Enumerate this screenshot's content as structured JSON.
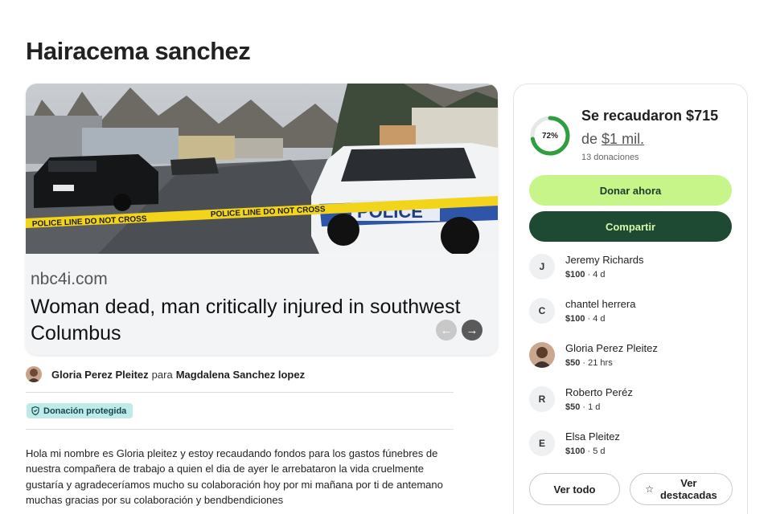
{
  "page": {
    "title": "Hairacema sanchez"
  },
  "media": {
    "image_alt": "Police car behind police line tape at a mobile home park",
    "tape_text": "POLICE LINE  DO NOT CROSS",
    "car_text": "POLICE",
    "caption_source": "nbc4i.com",
    "caption_headline": "Woman dead, man critically injured in southwest Columbus",
    "prev_icon": "arrow-left-icon",
    "next_icon": "arrow-right-icon"
  },
  "organizer": {
    "name": "Gloria Perez Pleitez",
    "connector": "para",
    "beneficiary": "Magdalena Sanchez lopez"
  },
  "badge": {
    "label": "Donación protegida",
    "icon": "shield-icon"
  },
  "description": "Hola mi nombre es Gloria pleitez y estoy recaudando fondos para los gastos fúnebres de nuestra compañera de trabajo a quien el dia de ayer le arrebataron la vida cruelmente gustaría y agradeceríamos mucho su colaboración hoy por mi mañana por ti de antemano muchas gracias por su colaboración y bendbendiciones",
  "fundraiser": {
    "progress_percent": 72,
    "progress_label": "72%",
    "raised_text": "Se recaudaron $715",
    "goal_prefix": "de",
    "goal_amount": "$1 mil.",
    "donation_count": "13 donaciones",
    "donate_label": "Donar ahora",
    "share_label": "Compartir",
    "accent_color": "#c8f58a",
    "dark_color": "#1e4a33"
  },
  "donors": [
    {
      "initial": "J",
      "name": "Jeremy Richards",
      "amount": "$100",
      "time": " · 4 d"
    },
    {
      "initial": "C",
      "name": "chantel herrera",
      "amount": "$100",
      "time": " · 4 d"
    },
    {
      "initial": "",
      "name": "Gloria Perez Pleitez",
      "amount": "$50",
      "time": " · 21 hrs"
    },
    {
      "initial": "R",
      "name": "Roberto Peréz",
      "amount": "$50",
      "time": " · 1 d"
    },
    {
      "initial": "E",
      "name": "Elsa Pleitez",
      "amount": "$100",
      "time": " · 5 d"
    }
  ],
  "actions": {
    "see_all": "Ver todo",
    "featured_line1": "Ver",
    "featured_line2": "destacadas",
    "featured_icon": "star-icon"
  }
}
